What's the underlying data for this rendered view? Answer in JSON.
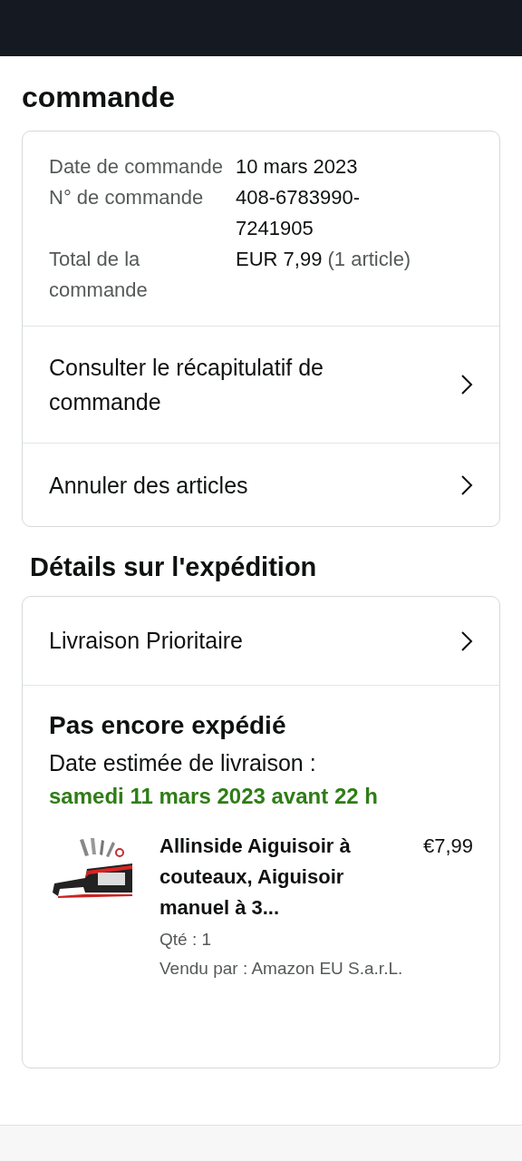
{
  "page_title": "commande",
  "order_summary": {
    "rows": [
      {
        "label": "Date de commande",
        "value": "10 mars 2023"
      },
      {
        "label": "N° de commande",
        "value": "408-6783990-7241905"
      },
      {
        "label": "Total de la commande",
        "value": "EUR 7,99",
        "note": "(1 article)"
      }
    ],
    "links": [
      "Consulter le récapitulatif de commande",
      "Annuler des articles"
    ]
  },
  "shipment": {
    "heading": "Détails sur l'expédition",
    "method": "Livraison Prioritaire",
    "status": "Pas encore expédié",
    "estimate_label": "Date estimée de livraison :",
    "estimate_date": "samedi 11 mars 2023 avant 22 h",
    "items": [
      {
        "kind": "picture",
        "title": "Allinside Aiguisoir à couteaux, Aiguisoir manuel à 3...",
        "price": "€7,99",
        "quantity": "Qté : 1",
        "seller": "Vendu par : Amazon EU S.a.r.L."
      }
    ]
  }
}
